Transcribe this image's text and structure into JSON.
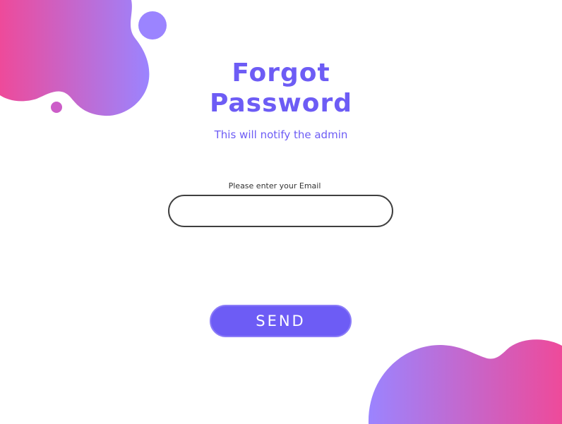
{
  "title": {
    "line1": "Forgot",
    "line2": "Password"
  },
  "subtitle": "This will notify the admin",
  "email": {
    "label": "Please enter your Email",
    "value": "",
    "placeholder": ""
  },
  "send_label": "SEND",
  "colors": {
    "accent": "#6d5cf5",
    "gradient_pink": "#ee4a9a",
    "gradient_purple": "#9b84ff",
    "dot_small": "#cc5dc8"
  }
}
